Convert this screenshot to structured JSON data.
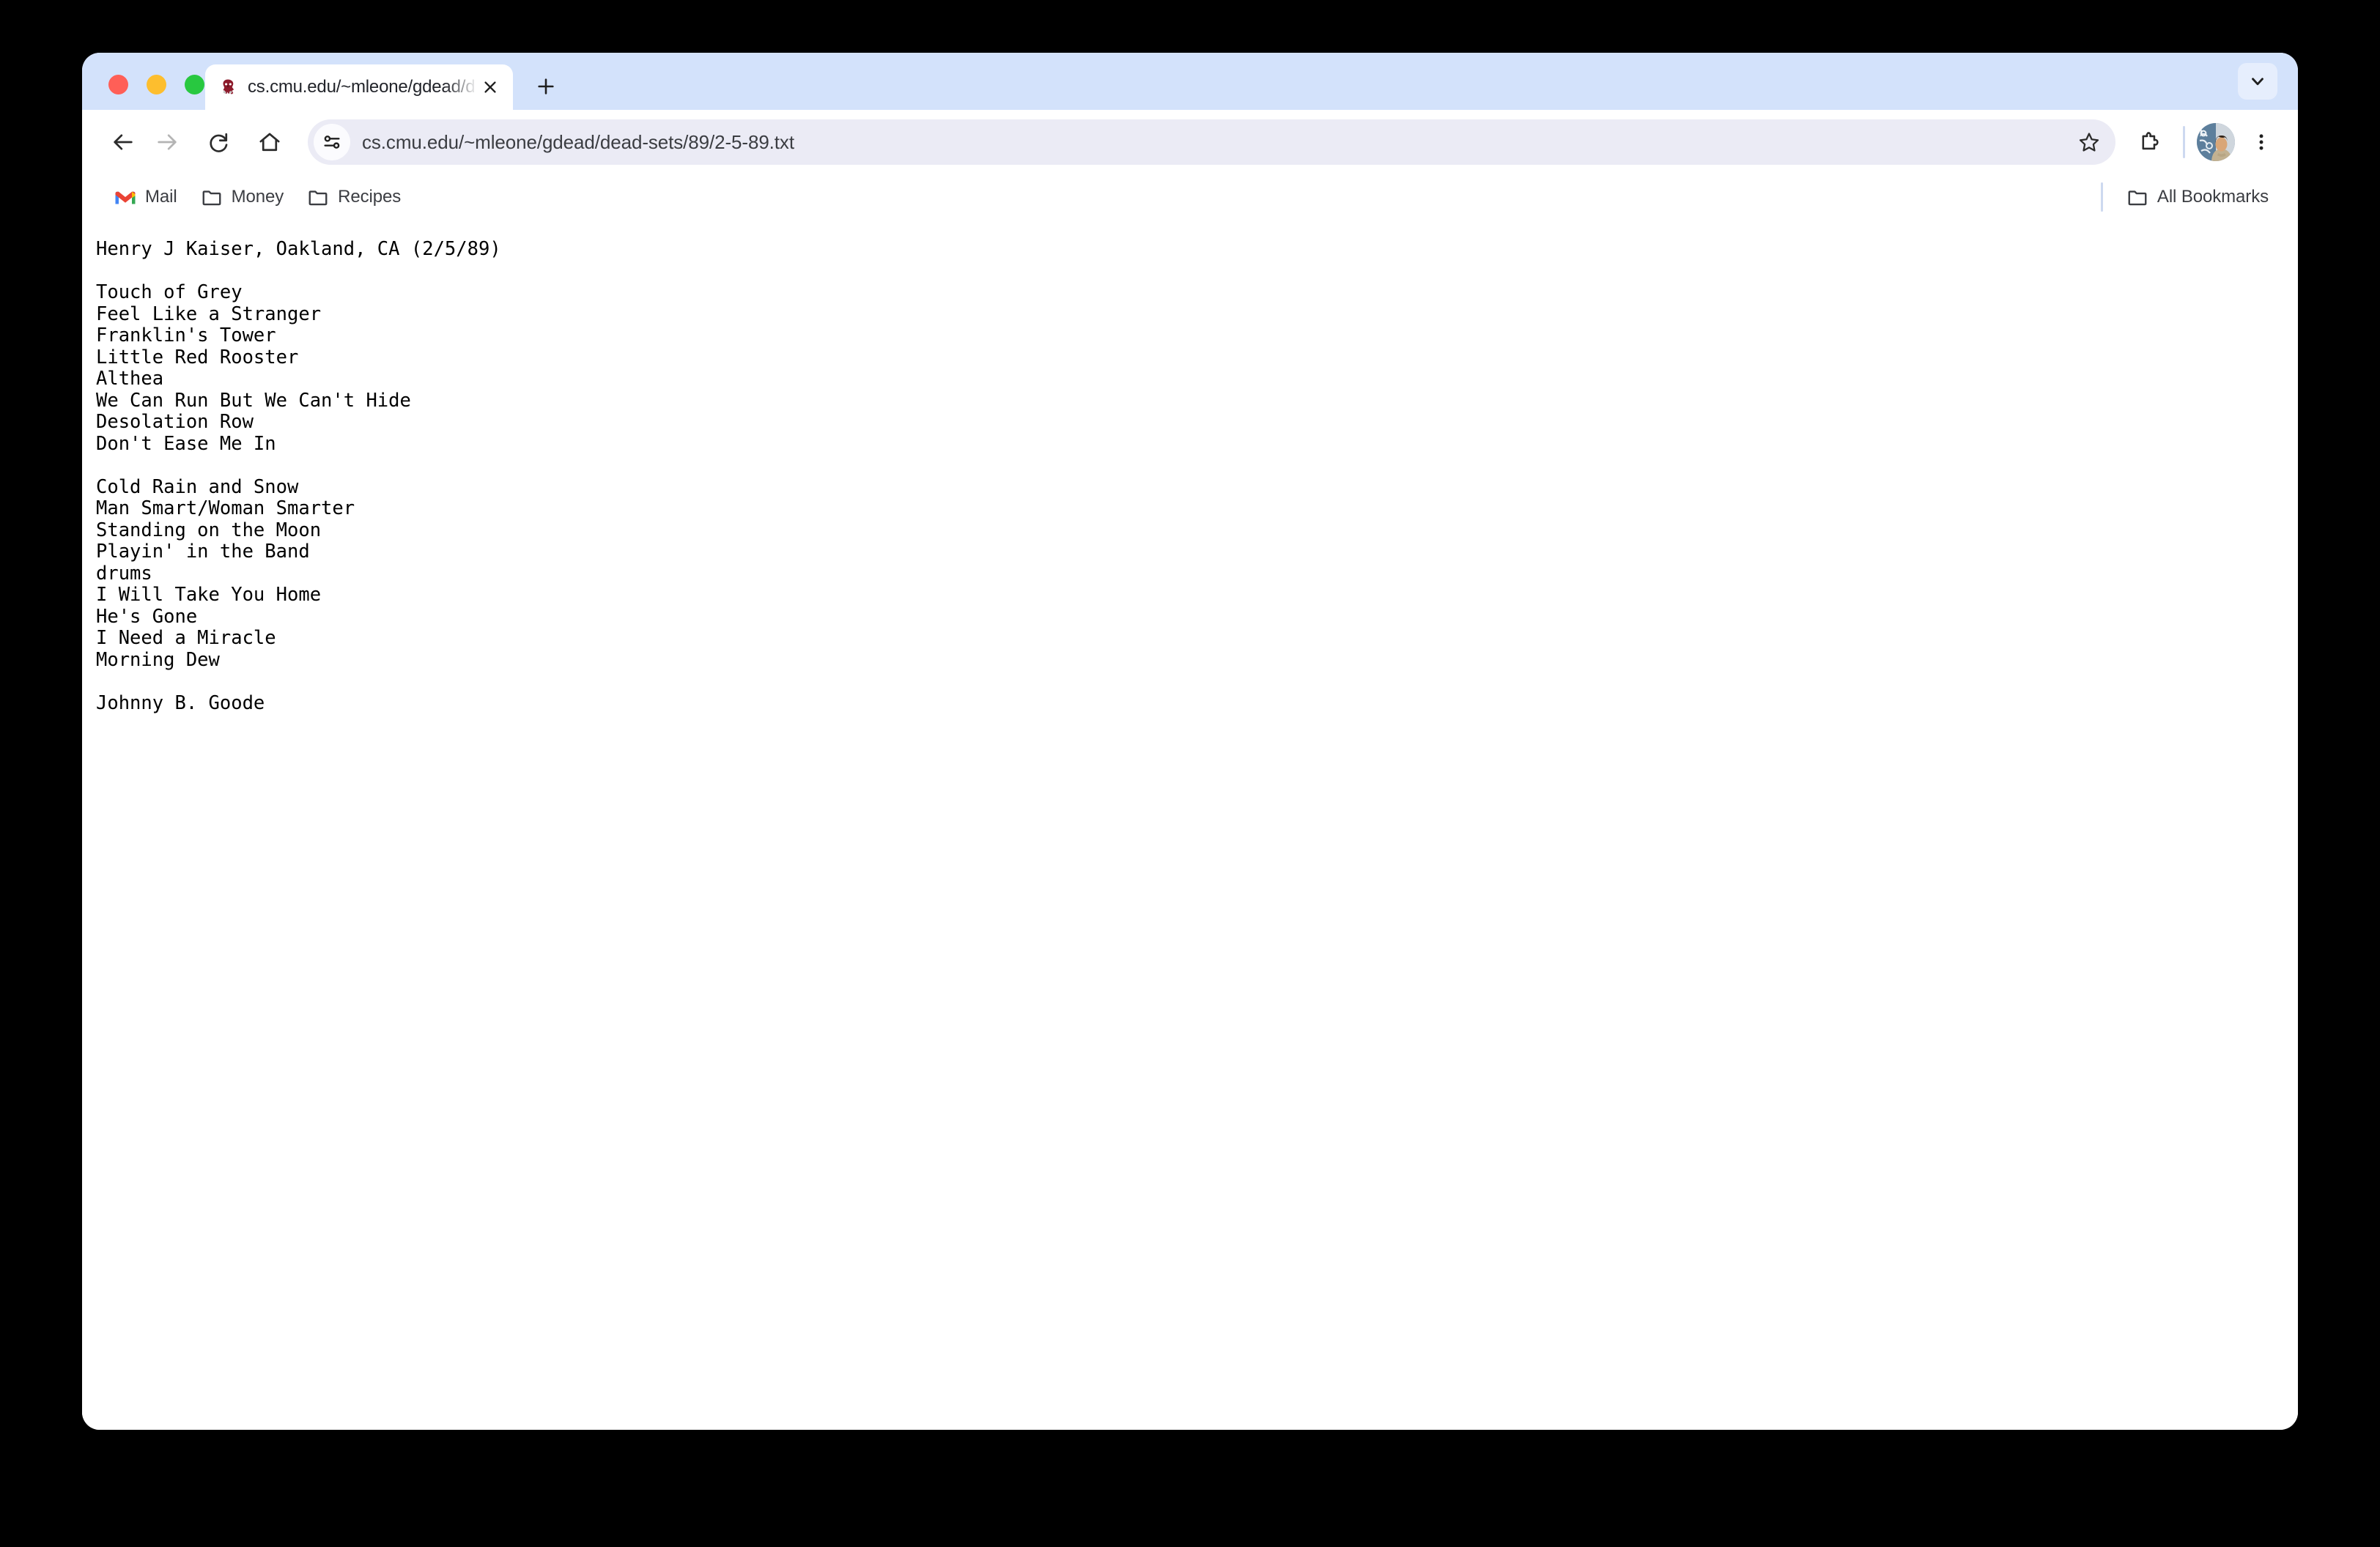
{
  "window": {
    "traffic_lights": [
      {
        "name": "close",
        "color": "#ff5f57"
      },
      {
        "name": "minimize",
        "color": "#fdbe2e"
      },
      {
        "name": "maximize",
        "color": "#28c840"
      }
    ],
    "chrome_colors": {
      "tab_strip": "#d3e2fb",
      "toolbar": "#ffffff",
      "omnibox": "#ebebf5",
      "desktop": "#000000"
    }
  },
  "tab_strip": {
    "tabs": [
      {
        "title": "cs.cmu.edu/~mleone/gdead/d",
        "favicon": "skeleton-favicon",
        "close_icon": "close-icon",
        "active": true
      }
    ],
    "new_tab_icon": "plus-icon",
    "tab_search_icon": "chevron-down-icon"
  },
  "toolbar": {
    "back_icon": "back-arrow-icon",
    "forward_icon": "forward-arrow-icon",
    "reload_icon": "reload-icon",
    "home_icon": "home-icon",
    "site_info_icon": "tune-sliders-icon",
    "url": "cs.cmu.edu/~mleone/gdead/dead-sets/89/2-5-89.txt",
    "url_placeholder": "Search Google or type a URL",
    "bookmark_star_icon": "star-icon",
    "extensions_icon": "puzzle-piece-icon",
    "profile_icon": "avatar",
    "menu_icon": "three-dot-menu-icon"
  },
  "bookmarks_bar": {
    "items": [
      {
        "label": "Mail",
        "icon": "gmail-icon"
      },
      {
        "label": "Money",
        "icon": "folder-icon"
      },
      {
        "label": "Recipes",
        "icon": "folder-icon"
      }
    ],
    "all_bookmarks": {
      "label": "All Bookmarks",
      "icon": "folder-icon"
    }
  },
  "page": {
    "venue_line": "Henry J Kaiser, Oakland, CA (2/5/89)",
    "set_one": [
      "Touch of Grey",
      "Feel Like a Stranger",
      "Franklin's Tower",
      "Little Red Rooster",
      "Althea",
      "We Can Run But We Can't Hide",
      "Desolation Row",
      "Don't Ease Me In"
    ],
    "set_two": [
      "Cold Rain and Snow",
      "Man Smart/Woman Smarter",
      "Standing on the Moon",
      "Playin' in the Band",
      "drums",
      "I Will Take You Home",
      "He's Gone",
      "I Need a Miracle",
      "Morning Dew"
    ],
    "encore": [
      "Johnny B. Goode"
    ],
    "full_text": "Henry J Kaiser, Oakland, CA (2/5/89)\n\nTouch of Grey\nFeel Like a Stranger\nFranklin's Tower\nLittle Red Rooster\nAlthea\nWe Can Run But We Can't Hide\nDesolation Row\nDon't Ease Me In\n\nCold Rain and Snow\nMan Smart/Woman Smarter\nStanding on the Moon\nPlayin' in the Band\ndrums\nI Will Take You Home\nHe's Gone\nI Need a Miracle\nMorning Dew\n\nJohnny B. Goode"
  }
}
